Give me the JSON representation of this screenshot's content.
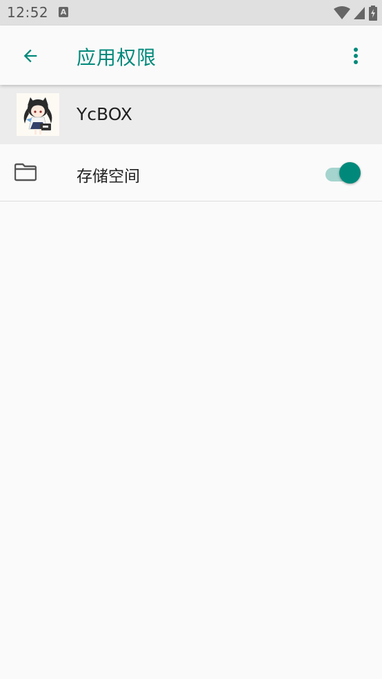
{
  "status_bar": {
    "time": "12:52",
    "notification_letter": "A",
    "icons": [
      "wifi-icon",
      "cell-signal-icon",
      "battery-charging-icon"
    ]
  },
  "app_bar": {
    "title": "应用权限",
    "back_icon": "arrow-back-icon",
    "more_icon": "more-vert-icon",
    "accent_color": "#00897b"
  },
  "app": {
    "name": "YcBOX"
  },
  "permissions": [
    {
      "label": "存储空间",
      "icon": "folder-icon",
      "enabled": true
    }
  ]
}
